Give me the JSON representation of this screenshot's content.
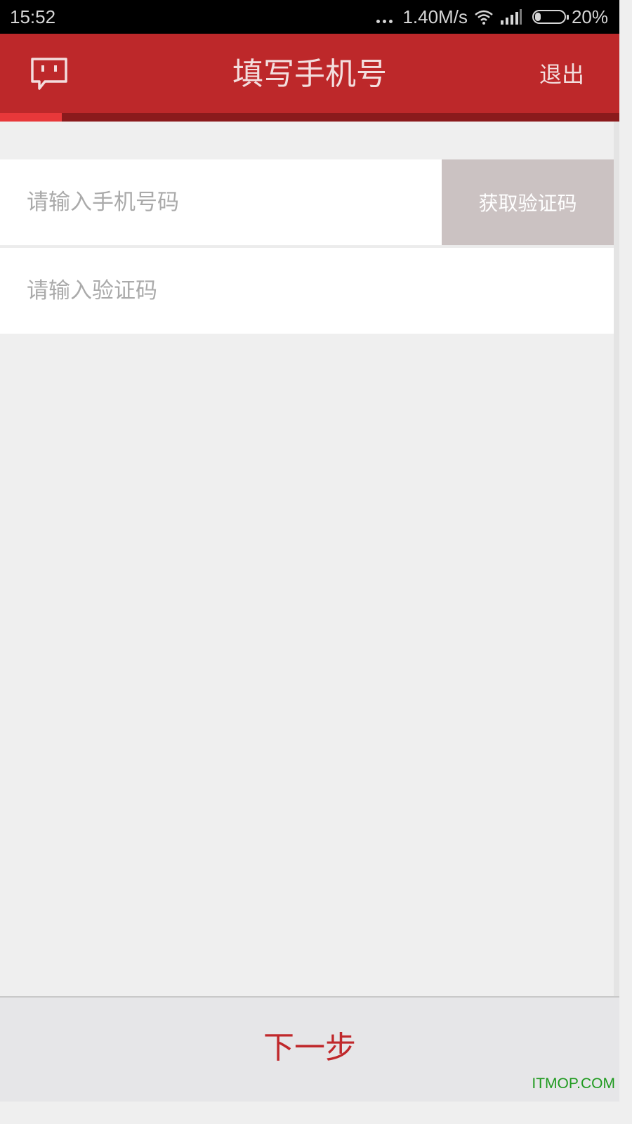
{
  "status_bar": {
    "time": "15:52",
    "network_speed": "1.40M/s",
    "battery_percent": "20%",
    "battery_level": 0.2,
    "icons": [
      "more-dots-icon",
      "wifi-icon",
      "signal-icon",
      "battery-icon"
    ]
  },
  "header": {
    "title": "填写手机号",
    "logout_label": "退出",
    "icon": "chat-bubble-icon",
    "progress": 0.1,
    "colors": {
      "background": "#bd282a",
      "progress_track": "#8b1a1c",
      "progress_fill": "#e8383a"
    }
  },
  "form": {
    "phone_placeholder": "请输入手机号码",
    "phone_value": "",
    "get_code_label": "获取验证码",
    "code_placeholder": "请输入验证码",
    "code_value": ""
  },
  "footer": {
    "next_label": "下一步"
  },
  "watermark": "ITMOP.COM"
}
